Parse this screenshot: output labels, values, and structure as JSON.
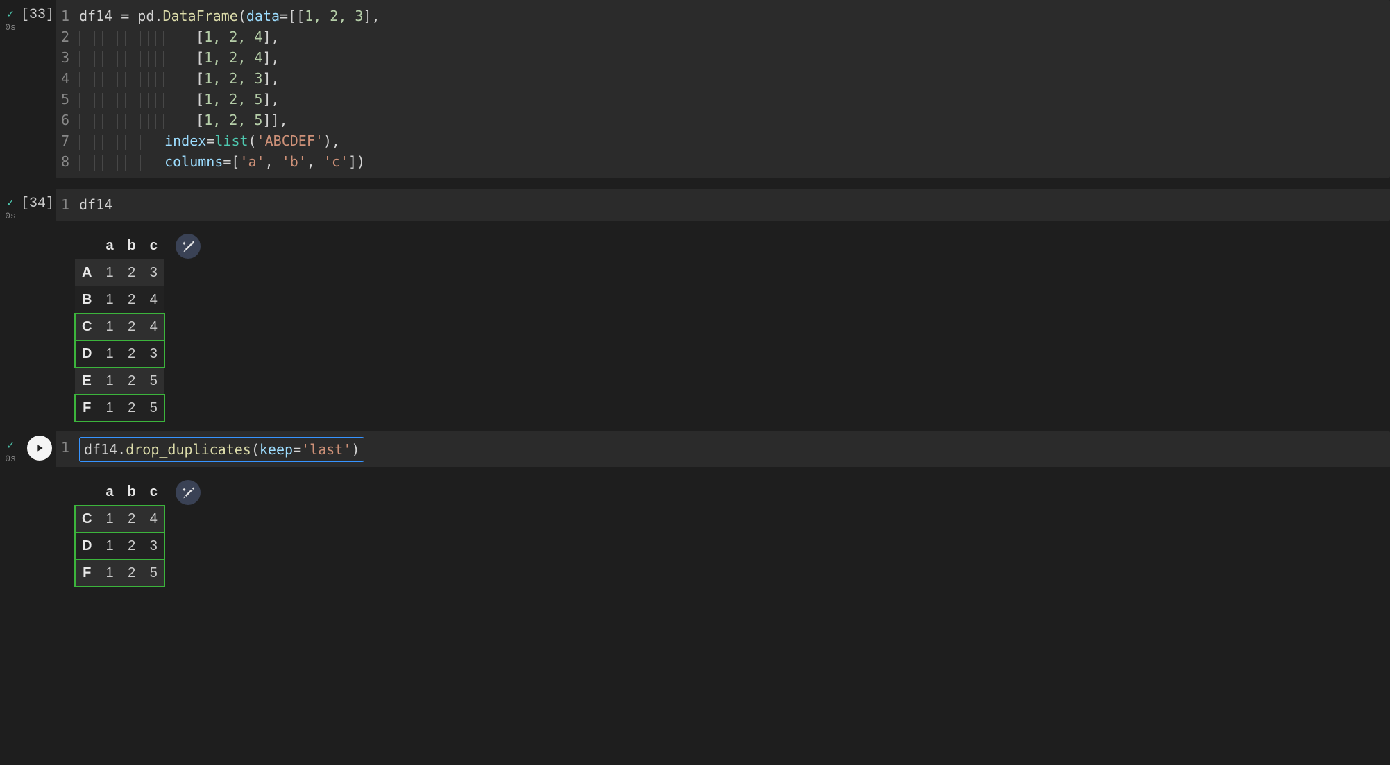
{
  "cells": {
    "cell1": {
      "status": "ok",
      "timing": "0s",
      "exec_count": "[33]",
      "line_numbers": [
        "1",
        "2",
        "3",
        "4",
        "5",
        "6",
        "7",
        "8"
      ],
      "code": {
        "l1_var": "df14",
        "l1_eq": " = ",
        "l1_pd": "pd",
        "l1_dot": ".",
        "l1_df": "DataFrame",
        "l1_open": "(",
        "l1_data": "data",
        "l1_eq2": "=[[",
        "l1_nums": "1, 2, 3",
        "l1_close": "],",
        "l2_open": "[",
        "l2_nums": "1, 2, 4",
        "l2_close": "],",
        "l3_open": "[",
        "l3_nums": "1, 2, 4",
        "l3_close": "],",
        "l4_open": "[",
        "l4_nums": "1, 2, 3",
        "l4_close": "],",
        "l5_open": "[",
        "l5_nums": "1, 2, 5",
        "l5_close": "],",
        "l6_open": "[",
        "l6_nums": "1, 2, 5",
        "l6_close": "]],",
        "l7_index": "index",
        "l7_eq": "=",
        "l7_list": "list",
        "l7_open": "(",
        "l7_str": "'ABCDEF'",
        "l7_close": "),",
        "l8_cols": "columns",
        "l8_eq": "=[",
        "l8_a": "'a'",
        "l8_c1": ", ",
        "l8_b": "'b'",
        "l8_c2": ", ",
        "l8_c": "'c'",
        "l8_close": "])"
      }
    },
    "cell2": {
      "status": "ok",
      "timing": "0s",
      "exec_count": "[34]",
      "line_numbers": [
        "1"
      ],
      "code": {
        "l1": "df14"
      },
      "output": {
        "columns": [
          "a",
          "b",
          "c"
        ],
        "rows": [
          {
            "idx": "A",
            "vals": [
              "1",
              "2",
              "3"
            ],
            "hl": false
          },
          {
            "idx": "B",
            "vals": [
              "1",
              "2",
              "4"
            ],
            "hl": false
          },
          {
            "idx": "C",
            "vals": [
              "1",
              "2",
              "4"
            ],
            "hl": true
          },
          {
            "idx": "D",
            "vals": [
              "1",
              "2",
              "3"
            ],
            "hl": true
          },
          {
            "idx": "E",
            "vals": [
              "1",
              "2",
              "5"
            ],
            "hl": false
          },
          {
            "idx": "F",
            "vals": [
              "1",
              "2",
              "5"
            ],
            "hl": true
          }
        ]
      }
    },
    "cell3": {
      "status": "ok",
      "timing": "0s",
      "line_numbers": [
        "1"
      ],
      "code": {
        "l1_var": "df14",
        "l1_dot": ".",
        "l1_fn": "drop_duplicates",
        "l1_open": "(",
        "l1_kw": "keep",
        "l1_eq": "=",
        "l1_str": "'last'",
        "l1_close": ")"
      },
      "output": {
        "columns": [
          "a",
          "b",
          "c"
        ],
        "rows": [
          {
            "idx": "C",
            "vals": [
              "1",
              "2",
              "4"
            ],
            "hl": true
          },
          {
            "idx": "D",
            "vals": [
              "1",
              "2",
              "3"
            ],
            "hl": true
          },
          {
            "idx": "F",
            "vals": [
              "1",
              "2",
              "5"
            ],
            "hl": true
          }
        ]
      }
    }
  }
}
